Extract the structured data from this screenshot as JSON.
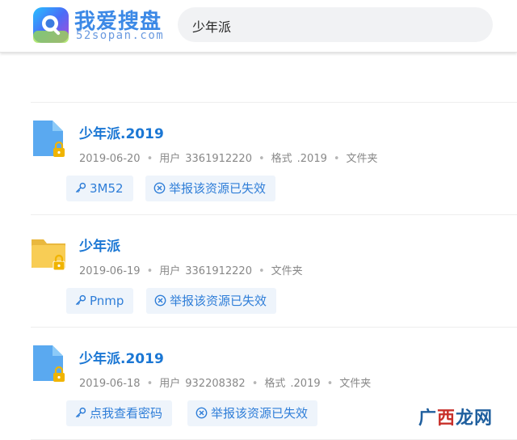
{
  "brand": {
    "name_cn": "我爱搜盘",
    "name_en": "52sopan.com"
  },
  "search": {
    "query": "少年派"
  },
  "results": [
    {
      "title": "少年派.2019",
      "date": "2019-06-20",
      "user_label": "用户",
      "user_id": "3361912220",
      "format_label": "格式",
      "format_value": ".2019",
      "type": "文件夹",
      "password": "3M52",
      "report": "举报该资源已失效"
    },
    {
      "title": "少年派",
      "date": "2019-06-19",
      "user_label": "用户",
      "user_id": "3361912220",
      "type": "文件夹",
      "password": "Pnmp",
      "report": "举报该资源已失效"
    },
    {
      "title": "少年派.2019",
      "date": "2019-06-18",
      "user_label": "用户",
      "user_id": "932208382",
      "format_label": "格式",
      "format_value": ".2019",
      "type": "文件夹",
      "password": "点我查看密码",
      "report": "举报该资源已失效"
    }
  ],
  "watermark": {
    "part1": "广",
    "part2": "西",
    "part3": "龙网"
  },
  "colors": {
    "accent": "#1b77d4",
    "tag_bg": "#eef4fb",
    "file_blue": "#5aa9f0",
    "folder_yellow": "#f6c84c",
    "lock": "#f0b400"
  }
}
